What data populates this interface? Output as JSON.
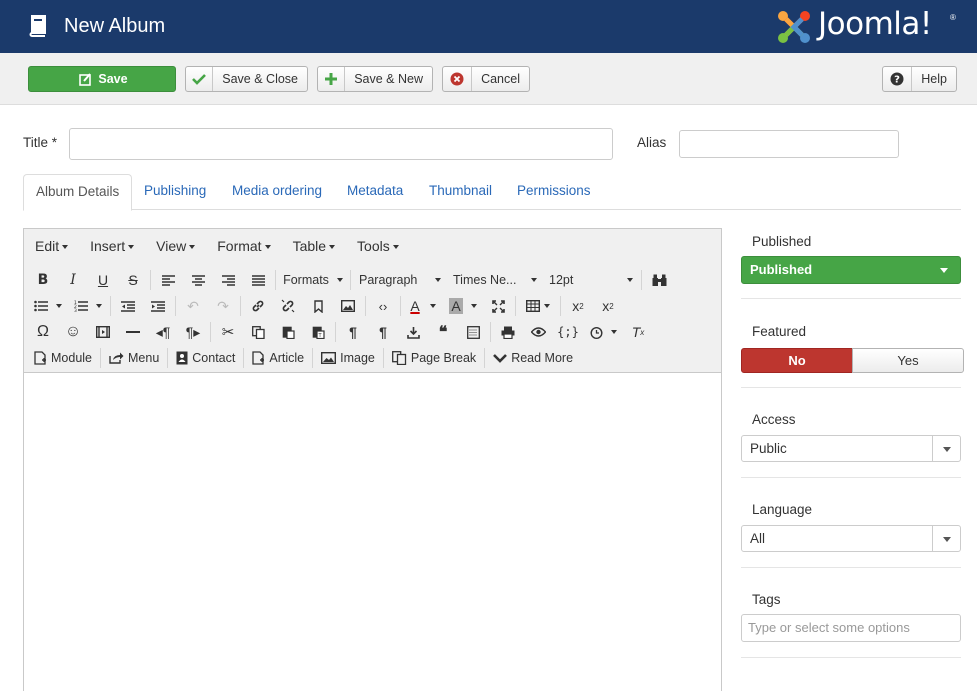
{
  "header": {
    "title": "New Album",
    "logo_text": "Joomla!",
    "logo_mark": "®",
    "icon": "book-icon"
  },
  "toolbar": {
    "save": "Save",
    "save_close": "Save & Close",
    "save_new": "Save & New",
    "cancel": "Cancel",
    "help": "Help"
  },
  "form": {
    "title_label": "Title *",
    "title_value": "",
    "alias_label": "Alias",
    "alias_value": ""
  },
  "tabs": [
    {
      "label": "Album Details",
      "active": true
    },
    {
      "label": "Publishing"
    },
    {
      "label": "Media ordering"
    },
    {
      "label": "Metadata"
    },
    {
      "label": "Thumbnail"
    },
    {
      "label": "Permissions"
    }
  ],
  "editor": {
    "menus": [
      "Edit",
      "Insert",
      "View",
      "Format",
      "Table",
      "Tools"
    ],
    "formats_label": "Formats",
    "block_label": "Paragraph",
    "font_label": "Times Ne...",
    "size_label": "12pt",
    "buttons": {
      "module": "Module",
      "menu": "Menu",
      "contact": "Contact",
      "article": "Article",
      "image": "Image",
      "page_break": "Page Break",
      "read_more": "Read More"
    }
  },
  "sidebar": {
    "published_label": "Published",
    "published_value": "Published",
    "featured_label": "Featured",
    "featured_no": "No",
    "featured_yes": "Yes",
    "access_label": "Access",
    "access_value": "Public",
    "language_label": "Language",
    "language_value": "All",
    "tags_label": "Tags",
    "tags_placeholder": "Type or select some options"
  },
  "colors": {
    "header_bg": "#1b3a6b",
    "success": "#46a546",
    "danger": "#bd362f",
    "link": "#2a69b8"
  }
}
